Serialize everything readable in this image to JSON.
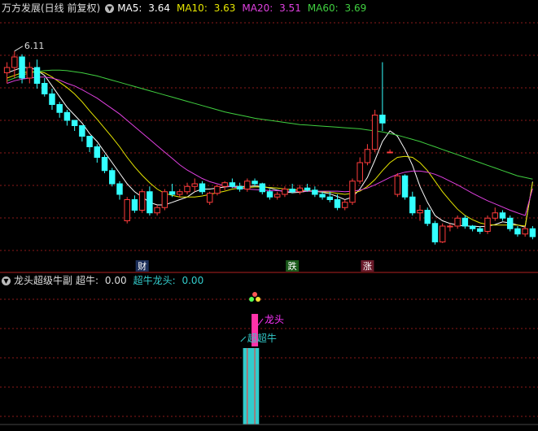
{
  "header": {
    "title": "万方发展(日线 前复权)",
    "ma": [
      {
        "label": "MA5:",
        "value": "3.64",
        "color": "#ffffff"
      },
      {
        "label": "MA10:",
        "value": "3.63",
        "color": "#e6e600"
      },
      {
        "label": "MA20:",
        "value": "3.51",
        "color": "#e040e0"
      },
      {
        "label": "MA60:",
        "value": "3.69",
        "color": "#40d040"
      }
    ]
  },
  "sub_header": {
    "name": "龙头超级牛副",
    "items": [
      {
        "label": "超牛:",
        "value": "0.00",
        "color": "#dddddd"
      },
      {
        "label": "超牛龙头:",
        "value": "0.00",
        "color": "#33cccc"
      }
    ]
  },
  "chart_data": [
    {
      "type": "candlestick",
      "title": "万方发展(日线 前复权)",
      "max_price_label": "6.11",
      "colors": {
        "up": "#ff3c3c",
        "down": "#33ffff",
        "ma5": "#ffffff",
        "ma10": "#e6e600",
        "ma20": "#e040e0",
        "ma60": "#40d040"
      },
      "ylim": [
        2.2,
        6.8
      ],
      "ohlc": [
        [
          5.7,
          5.9,
          5.5,
          5.8
        ],
        [
          5.8,
          6.11,
          5.6,
          6.0
        ],
        [
          6.0,
          6.05,
          5.5,
          5.6
        ],
        [
          5.6,
          5.9,
          5.5,
          5.8
        ],
        [
          5.8,
          5.95,
          5.4,
          5.5
        ],
        [
          5.5,
          5.6,
          5.25,
          5.3
        ],
        [
          5.3,
          5.4,
          5.0,
          5.1
        ],
        [
          5.1,
          5.15,
          4.85,
          4.95
        ],
        [
          4.95,
          5.0,
          4.7,
          4.8
        ],
        [
          4.8,
          4.8,
          4.6,
          4.7
        ],
        [
          4.7,
          4.7,
          4.4,
          4.5
        ],
        [
          4.5,
          4.5,
          4.2,
          4.3
        ],
        [
          4.3,
          4.35,
          4.0,
          4.1
        ],
        [
          4.1,
          4.15,
          3.8,
          3.85
        ],
        [
          3.85,
          3.9,
          3.55,
          3.6
        ],
        [
          3.6,
          3.65,
          3.3,
          3.4
        ],
        [
          2.9,
          3.35,
          2.85,
          3.3
        ],
        [
          3.3,
          3.38,
          3.05,
          3.1
        ],
        [
          3.1,
          3.5,
          3.05,
          3.45
        ],
        [
          3.45,
          3.55,
          3.0,
          3.05
        ],
        [
          3.05,
          3.2,
          3.0,
          3.15
        ],
        [
          3.15,
          3.5,
          3.1,
          3.45
        ],
        [
          3.45,
          3.6,
          3.35,
          3.4
        ],
        [
          3.4,
          3.5,
          3.35,
          3.45
        ],
        [
          3.45,
          3.62,
          3.4,
          3.55
        ],
        [
          3.55,
          3.7,
          3.45,
          3.6
        ],
        [
          3.6,
          3.65,
          3.4,
          3.45
        ],
        [
          3.25,
          3.45,
          3.2,
          3.42
        ],
        [
          3.42,
          3.58,
          3.38,
          3.55
        ],
        [
          3.55,
          3.65,
          3.48,
          3.62
        ],
        [
          3.62,
          3.7,
          3.52,
          3.55
        ],
        [
          3.55,
          3.62,
          3.45,
          3.5
        ],
        [
          3.5,
          3.7,
          3.45,
          3.65
        ],
        [
          3.65,
          3.7,
          3.55,
          3.6
        ],
        [
          3.6,
          3.62,
          3.4,
          3.45
        ],
        [
          3.45,
          3.5,
          3.3,
          3.35
        ],
        [
          3.35,
          3.45,
          3.3,
          3.4
        ],
        [
          3.4,
          3.55,
          3.35,
          3.5
        ],
        [
          3.5,
          3.6,
          3.42,
          3.45
        ],
        [
          3.45,
          3.58,
          3.4,
          3.52
        ],
        [
          3.52,
          3.6,
          3.45,
          3.48
        ],
        [
          3.48,
          3.55,
          3.35,
          3.4
        ],
        [
          3.4,
          3.45,
          3.3,
          3.35
        ],
        [
          3.35,
          3.45,
          3.25,
          3.3
        ],
        [
          3.3,
          3.4,
          3.1,
          3.15
        ],
        [
          3.15,
          3.3,
          3.1,
          3.25
        ],
        [
          3.25,
          3.7,
          3.2,
          3.65
        ],
        [
          3.65,
          4.1,
          3.6,
          4.0
        ],
        [
          4.0,
          4.35,
          3.95,
          4.25
        ],
        [
          4.25,
          5.0,
          4.2,
          4.9
        ],
        [
          4.9,
          5.9,
          4.6,
          4.75
        ],
        [
          4.2,
          4.25,
          4.18,
          4.2
        ],
        [
          3.4,
          3.8,
          3.35,
          3.75
        ],
        [
          3.75,
          3.78,
          3.3,
          3.35
        ],
        [
          3.35,
          3.45,
          3.0,
          3.05
        ],
        [
          3.05,
          3.2,
          2.9,
          3.1
        ],
        [
          3.1,
          3.15,
          2.8,
          2.85
        ],
        [
          2.85,
          2.9,
          2.45,
          2.5
        ],
        [
          2.5,
          2.85,
          2.48,
          2.8
        ],
        [
          2.8,
          2.85,
          2.7,
          2.8
        ],
        [
          2.8,
          3.0,
          2.75,
          2.95
        ],
        [
          2.95,
          3.0,
          2.75,
          2.8
        ],
        [
          2.8,
          2.82,
          2.7,
          2.75
        ],
        [
          2.75,
          2.8,
          2.65,
          2.7
        ],
        [
          2.7,
          3.0,
          2.65,
          2.95
        ],
        [
          2.95,
          3.15,
          2.9,
          3.05
        ],
        [
          3.05,
          3.1,
          2.9,
          2.95
        ],
        [
          2.95,
          3.0,
          2.7,
          2.75
        ],
        [
          2.75,
          2.8,
          2.6,
          2.65
        ],
        [
          2.65,
          2.8,
          2.6,
          2.75
        ],
        [
          2.75,
          2.8,
          2.55,
          2.6
        ]
      ],
      "series": [
        {
          "name": "MA5",
          "values": [
            5.7,
            5.75,
            5.8,
            5.8,
            5.75,
            5.65,
            5.45,
            5.25,
            5.05,
            4.9,
            4.75,
            4.55,
            4.4,
            4.2,
            4.0,
            3.8,
            3.6,
            3.45,
            3.35,
            3.25,
            3.2,
            3.2,
            3.25,
            3.3,
            3.35,
            3.45,
            3.5,
            3.5,
            3.52,
            3.54,
            3.55,
            3.55,
            3.55,
            3.56,
            3.55,
            3.52,
            3.48,
            3.45,
            3.43,
            3.44,
            3.46,
            3.46,
            3.44,
            3.41,
            3.36,
            3.3,
            3.35,
            3.5,
            3.72,
            4.05,
            4.4,
            4.6,
            4.5,
            4.25,
            3.95,
            3.55,
            3.25,
            3.0,
            2.9,
            2.85,
            2.82,
            2.8,
            2.8,
            2.79,
            2.8,
            2.83,
            2.88,
            2.86,
            2.82,
            2.78,
            3.64
          ]
        },
        {
          "name": "MA10",
          "values": [
            5.6,
            5.65,
            5.7,
            5.72,
            5.72,
            5.7,
            5.62,
            5.52,
            5.42,
            5.3,
            5.15,
            4.98,
            4.82,
            4.65,
            4.48,
            4.3,
            4.1,
            3.92,
            3.76,
            3.62,
            3.5,
            3.42,
            3.38,
            3.35,
            3.35,
            3.35,
            3.37,
            3.4,
            3.43,
            3.46,
            3.5,
            3.52,
            3.53,
            3.54,
            3.54,
            3.53,
            3.52,
            3.5,
            3.49,
            3.48,
            3.47,
            3.46,
            3.45,
            3.44,
            3.42,
            3.4,
            3.42,
            3.46,
            3.55,
            3.68,
            3.85,
            4.0,
            4.1,
            4.12,
            4.1,
            4.0,
            3.85,
            3.65,
            3.45,
            3.28,
            3.12,
            3.0,
            2.92,
            2.86,
            2.83,
            2.82,
            2.82,
            2.82,
            2.82,
            2.8,
            3.63
          ]
        },
        {
          "name": "MA20",
          "values": [
            5.5,
            5.55,
            5.58,
            5.6,
            5.62,
            5.62,
            5.6,
            5.56,
            5.5,
            5.45,
            5.38,
            5.3,
            5.22,
            5.12,
            5.02,
            4.92,
            4.8,
            4.68,
            4.56,
            4.44,
            4.32,
            4.2,
            4.08,
            3.96,
            3.86,
            3.78,
            3.7,
            3.64,
            3.6,
            3.56,
            3.54,
            3.52,
            3.5,
            3.49,
            3.48,
            3.47,
            3.47,
            3.46,
            3.46,
            3.46,
            3.46,
            3.46,
            3.46,
            3.46,
            3.46,
            3.45,
            3.46,
            3.48,
            3.52,
            3.58,
            3.65,
            3.72,
            3.78,
            3.82,
            3.84,
            3.84,
            3.82,
            3.78,
            3.72,
            3.65,
            3.58,
            3.5,
            3.42,
            3.35,
            3.28,
            3.22,
            3.16,
            3.1,
            3.05,
            3.0,
            3.51
          ]
        },
        {
          "name": "MA60",
          "values": [
            5.55,
            5.6,
            5.65,
            5.7,
            5.72,
            5.74,
            5.75,
            5.75,
            5.74,
            5.72,
            5.7,
            5.67,
            5.64,
            5.6,
            5.56,
            5.52,
            5.48,
            5.44,
            5.4,
            5.36,
            5.32,
            5.28,
            5.24,
            5.2,
            5.16,
            5.12,
            5.08,
            5.04,
            5.0,
            4.96,
            4.93,
            4.9,
            4.87,
            4.84,
            4.82,
            4.8,
            4.78,
            4.76,
            4.74,
            4.72,
            4.71,
            4.7,
            4.69,
            4.68,
            4.67,
            4.66,
            4.65,
            4.64,
            4.62,
            4.6,
            4.58,
            4.55,
            4.52,
            4.48,
            4.44,
            4.4,
            4.35,
            4.3,
            4.25,
            4.2,
            4.15,
            4.1,
            4.05,
            4.0,
            3.95,
            3.9,
            3.85,
            3.8,
            3.75,
            3.72,
            3.69
          ]
        }
      ],
      "markers": [
        {
          "index": 18,
          "label": "财",
          "color": "#ffffff",
          "bg": "#1c2f5a"
        },
        {
          "index": 38,
          "label": "跌",
          "color": "#ffffff",
          "bg": "#1a5a1a"
        },
        {
          "index": 48,
          "label": "涨",
          "color": "#ffffff",
          "bg": "#6a1a2a"
        }
      ]
    },
    {
      "type": "bar",
      "title": "龙头超级牛副",
      "annotations": [
        {
          "label": "龙头",
          "color": "#ff33ff"
        },
        {
          "label": "超超牛",
          "color": "#33cccc"
        }
      ],
      "bars": [
        {
          "index": 32,
          "color": "#33cccc",
          "value": 1.0
        },
        {
          "index": 33,
          "color": "#33cccc",
          "value": 1.0
        },
        {
          "index": 33,
          "color": "#ff33aa",
          "value": 1.0,
          "top": true
        }
      ]
    }
  ]
}
